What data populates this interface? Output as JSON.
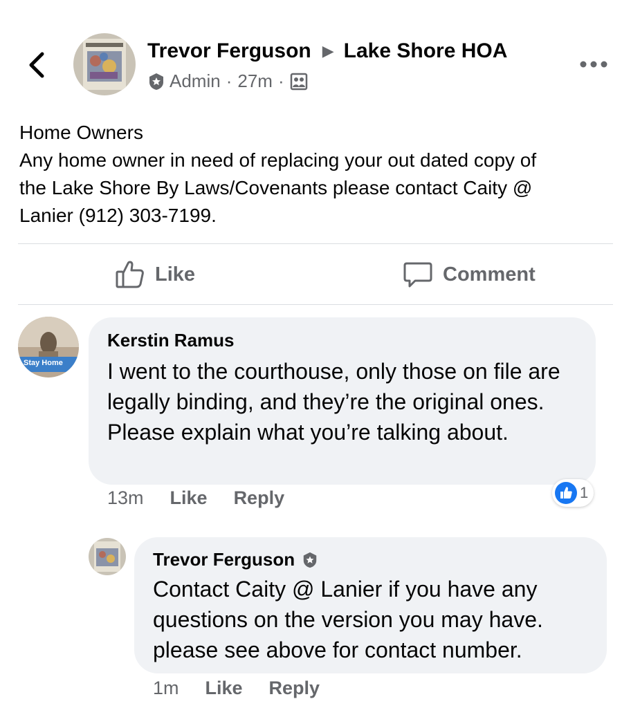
{
  "header": {
    "author": "Trevor Ferguson",
    "group": "Lake Shore HOA",
    "role": "Admin",
    "time": "27m",
    "separator": "·"
  },
  "post": {
    "lines": [
      "Home Owners",
      "Any home owner in need of replacing your out dated copy of",
      "the Lake Shore By Laws/Covenants please contact Caity @",
      "Lanier (912) 303-7199."
    ]
  },
  "actions": {
    "like_label": "Like",
    "comment_label": "Comment"
  },
  "comments": [
    {
      "author": "Kerstin Ramus",
      "text": "I went to the courthouse, only those on file are legally binding, and they’re the original ones. Please explain what you’re talking about.",
      "time": "13m",
      "like_label": "Like",
      "reply_label": "Reply",
      "reaction_count": "1",
      "avatar_text": "Stay Home"
    },
    {
      "author": "Trevor Ferguson",
      "text": "Contact Caity @ Lanier if you have any questions on the version you may have. please see above for contact number.",
      "time": "1m",
      "like_label": "Like",
      "reply_label": "Reply"
    }
  ],
  "icons": {
    "back": "chevron-left-icon",
    "more": "more-horizontal-icon",
    "admin_badge": "admin-badge-icon",
    "audience": "group-audience-icon",
    "like": "thumbs-up-icon",
    "comment": "comment-icon",
    "reaction": "like-reaction-icon"
  },
  "colors": {
    "text_primary": "#050505",
    "text_secondary": "#65676b",
    "bubble": "#f0f2f5",
    "divider": "#dadde1",
    "like_blue": "#1877f2"
  }
}
